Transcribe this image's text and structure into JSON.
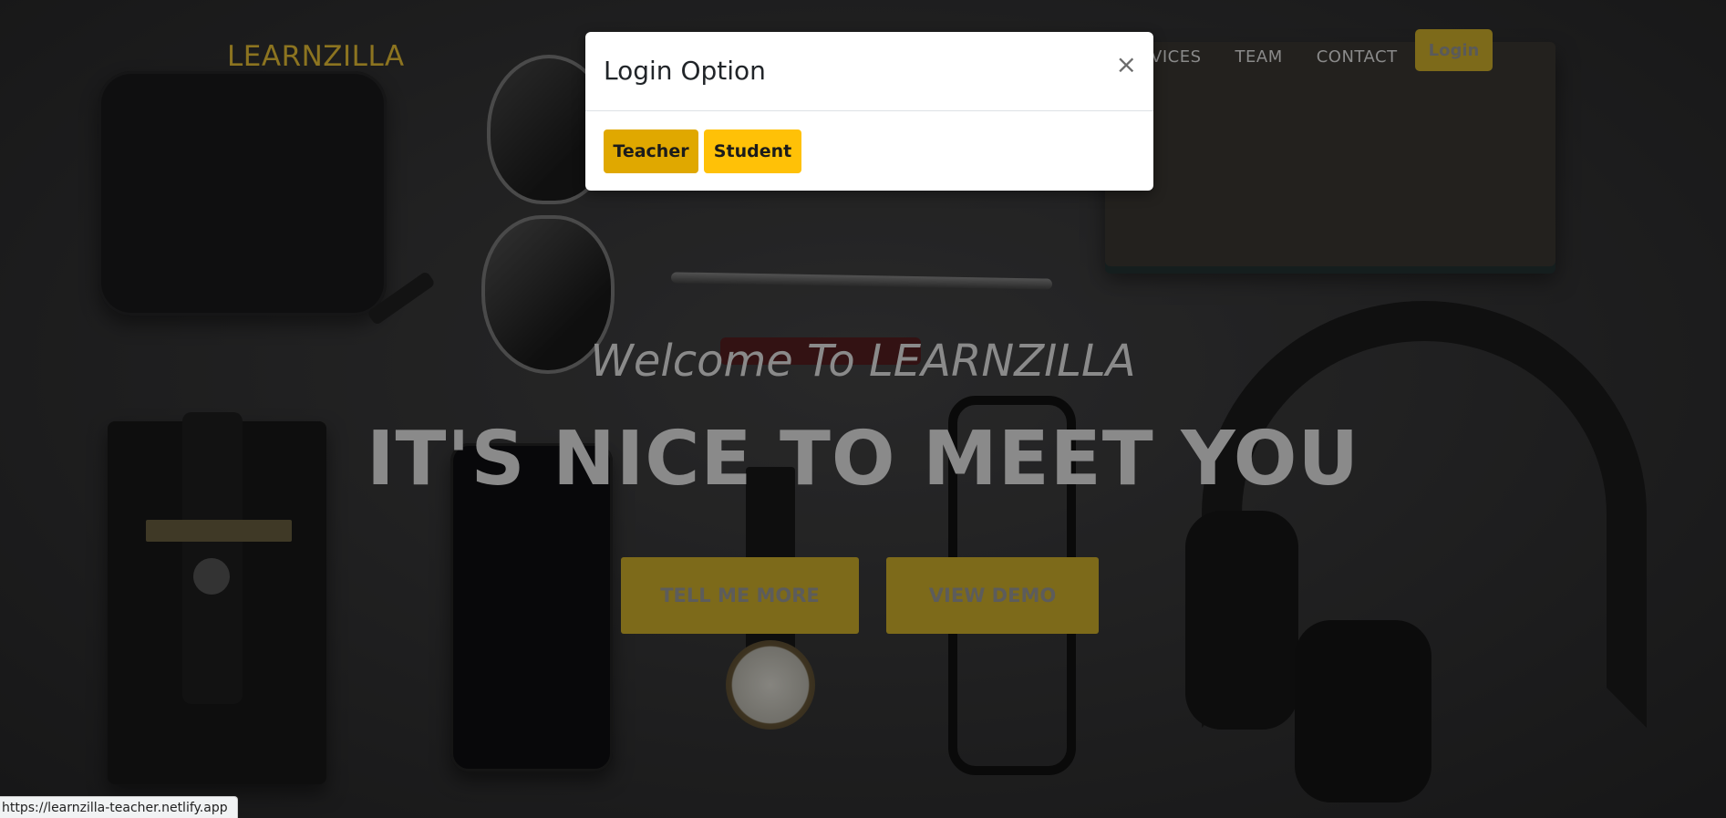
{
  "colors": {
    "accent": "#ffc107",
    "accent_active": "#e0a800",
    "dimmed_accent": "#7d6a1a",
    "brand_dimmed": "#8c7420"
  },
  "navbar": {
    "brand": "LEARNZILLA",
    "links": [
      "RVICES",
      "TEAM",
      "CONTACT"
    ],
    "login_label": "Login"
  },
  "hero": {
    "subtitle": "Welcome To LEARNZILLA",
    "title": "IT'S NICE TO MEET YOU",
    "buttons": {
      "more": "TELL ME MORE",
      "demo": "VIEW DEMO"
    }
  },
  "modal": {
    "title": "Login Option",
    "close_icon": "×",
    "teacher_label": "Teacher",
    "student_label": "Student"
  },
  "status_bar": {
    "url": "https://learnzilla-teacher.netlify.app"
  }
}
